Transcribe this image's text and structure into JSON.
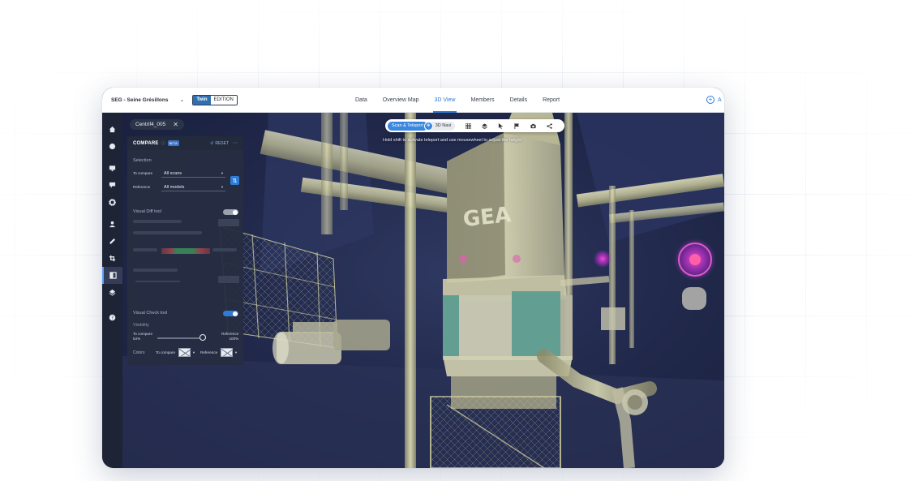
{
  "header": {
    "project_name": "SEG - Seine Grésillons",
    "edition_badge": "Twin",
    "edition_label": "EDITION",
    "add_label": "A"
  },
  "nav": {
    "tabs": [
      "Data",
      "Overview Map",
      "3D View",
      "Members",
      "Details",
      "Report"
    ],
    "active": "3D View"
  },
  "rail": {
    "icons": [
      "home-icon",
      "circle-icon",
      "monitor-icon",
      "pin-icon",
      "gear-icon",
      "person-pin-icon",
      "ruler-icon",
      "crop-icon",
      "compare-icon",
      "layers-icon",
      "help-icon"
    ],
    "active_icon": "compare-icon"
  },
  "scan_chip": {
    "name": "Centrif4_005"
  },
  "compare": {
    "title": "COMPARE",
    "beta": "BETA",
    "reset": "RESET",
    "selection_title": "Selection",
    "to_compare_label": "To compare",
    "to_compare_value": "All scans",
    "reference_label": "Reference",
    "reference_value": "All models",
    "visual_diff_title": "Visual Diff tool",
    "visual_diff_on": false,
    "visual_check_title": "Visual Check tool",
    "visual_check_on": true,
    "visibility_title": "Visibility",
    "vis_to_compare_label": "To compare",
    "vis_to_compare_pct": "54%",
    "vis_reference_label": "Reference",
    "vis_reference_pct": "100%",
    "visibility_level": 0.54,
    "colors_label": "Colors",
    "colors_to_compare": "To compare",
    "colors_reference": "Reference"
  },
  "toolbar": {
    "mode_active": "Scan & Teleport",
    "mode_other": "3D Navi",
    "icons": [
      "grid-icon",
      "layers-stack-icon",
      "pointer-icon",
      "flag-icon",
      "camera-icon",
      "share-icon"
    ]
  },
  "hint": "Hold shift to activate teleport and use mousewheel to adjust the height",
  "scene": {
    "logo_text": "GEA",
    "pipe_color": "#d8d6a3",
    "machine_teal": "#5a9c8f",
    "marker_color": "#c43fd0"
  }
}
